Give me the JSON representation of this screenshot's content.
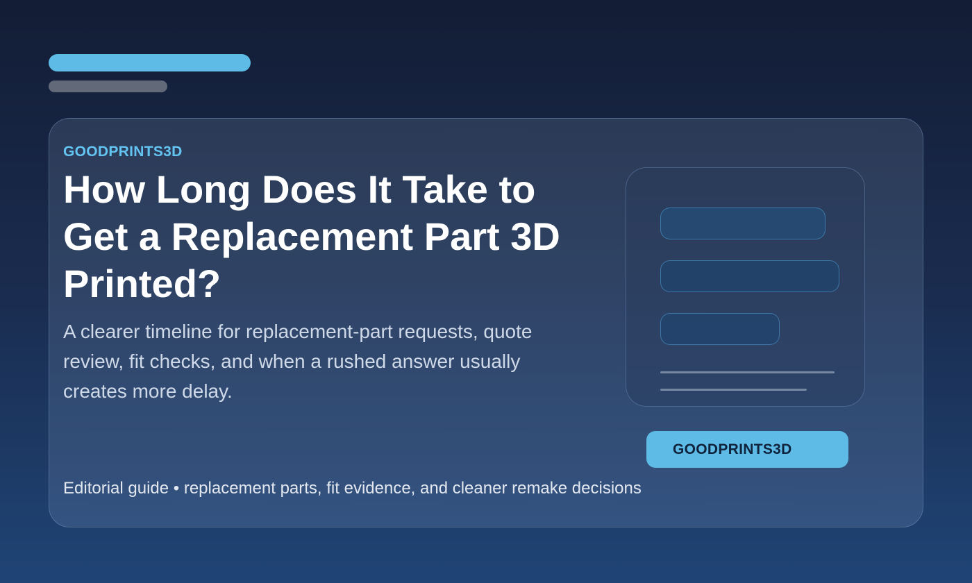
{
  "card": {
    "brand": "GOODPRINTS3D",
    "headline": "How Long Does It Take to Get a Replacement Part 3D Printed?",
    "subhead": "A clearer timeline for replacement-part requests, quote review, fit checks, and when a rushed answer usually creates more delay.",
    "footer": "Editorial guide • replacement parts, fit evidence, and cleaner remake decisions",
    "button_label": "GOODPRINTS3D"
  },
  "colors": {
    "accent": "#5dbbe6",
    "brand_text": "#63c4f1",
    "headline_text": "#ffffff",
    "background_top": "#131d35",
    "background_bottom": "#1f4475"
  }
}
